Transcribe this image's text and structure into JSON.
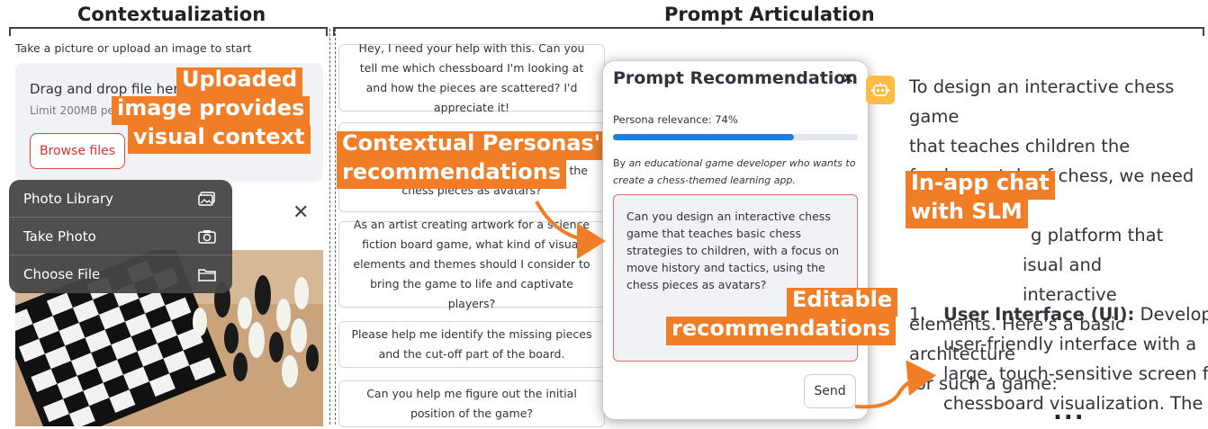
{
  "sections": {
    "left_title": "Contextualization",
    "right_title": "Prompt Articulation"
  },
  "uploader": {
    "caption": "Take a picture or upload an image to start",
    "drop_title": "Drag and drop file here",
    "drop_limit": "Limit 200MB pe",
    "browse_label": "Browse files",
    "close_symbol": "✕"
  },
  "ios_menu": {
    "items": [
      {
        "label": "Photo Library",
        "icon": "photo-library-icon"
      },
      {
        "label": "Take Photo",
        "icon": "camera-icon"
      },
      {
        "label": "Choose File",
        "icon": "folder-icon"
      }
    ]
  },
  "prompts": [
    {
      "text": "Hey, I need your help with this. Can you tell me which chessboard I'm looking at and how the pieces are scattered? I'd appreciate it!"
    },
    {
      "text_tail": "g the",
      "text_last": "chess pieces as avatars?"
    },
    {
      "text": "As an artist creating artwork for a science fiction board game, what kind of visual elements and themes should I consider to bring the game to life and captivate players?"
    },
    {
      "text": "Please help me identify the missing pieces and the cut-off part of the board."
    },
    {
      "text": "Can you help me figure out the initial position of the game?"
    }
  ],
  "dialog": {
    "title": "Prompt Recommendation",
    "close_symbol": "×",
    "relevance_label": "Persona relevance: 74%",
    "relevance_value": 0.74,
    "persona_by": "By",
    "persona_desc": "an educational game developer who wants to create a chess-themed learning app.",
    "recommendation": "Can you design an interactive chess game that teaches basic chess strategies to children, with a focus on move history and tactics, using the chess pieces as avatars?",
    "send_label": "Send"
  },
  "chat": {
    "intro_lines": [
      "To design an interactive chess game",
      "that teaches children the",
      "fundamentals of chess, we need to",
      "g platform that",
      "isual and interactive",
      "elements. Here's a basic architecture",
      "for such a game:"
    ],
    "list_number": "1.",
    "list_bold": "User Interface (UI):",
    "list_lines": [
      "Develop a",
      "user-friendly interface with a",
      "large, touch-sensitive screen for",
      "chessboard visualization. The"
    ],
    "ellipsis": "..."
  },
  "annotations": {
    "uploaded": [
      "Uploaded",
      "image provides",
      "visual context"
    ],
    "personas": [
      "Contextual Personas'",
      "recommendations"
    ],
    "editable": [
      "Editable",
      "recommendations"
    ],
    "inapp": [
      "In-app chat",
      "with SLM"
    ]
  },
  "colors": {
    "annotation": "#f27d27",
    "progress": "#1f7fe0",
    "bot": "#ffbd45",
    "browse": "#dd3333"
  }
}
